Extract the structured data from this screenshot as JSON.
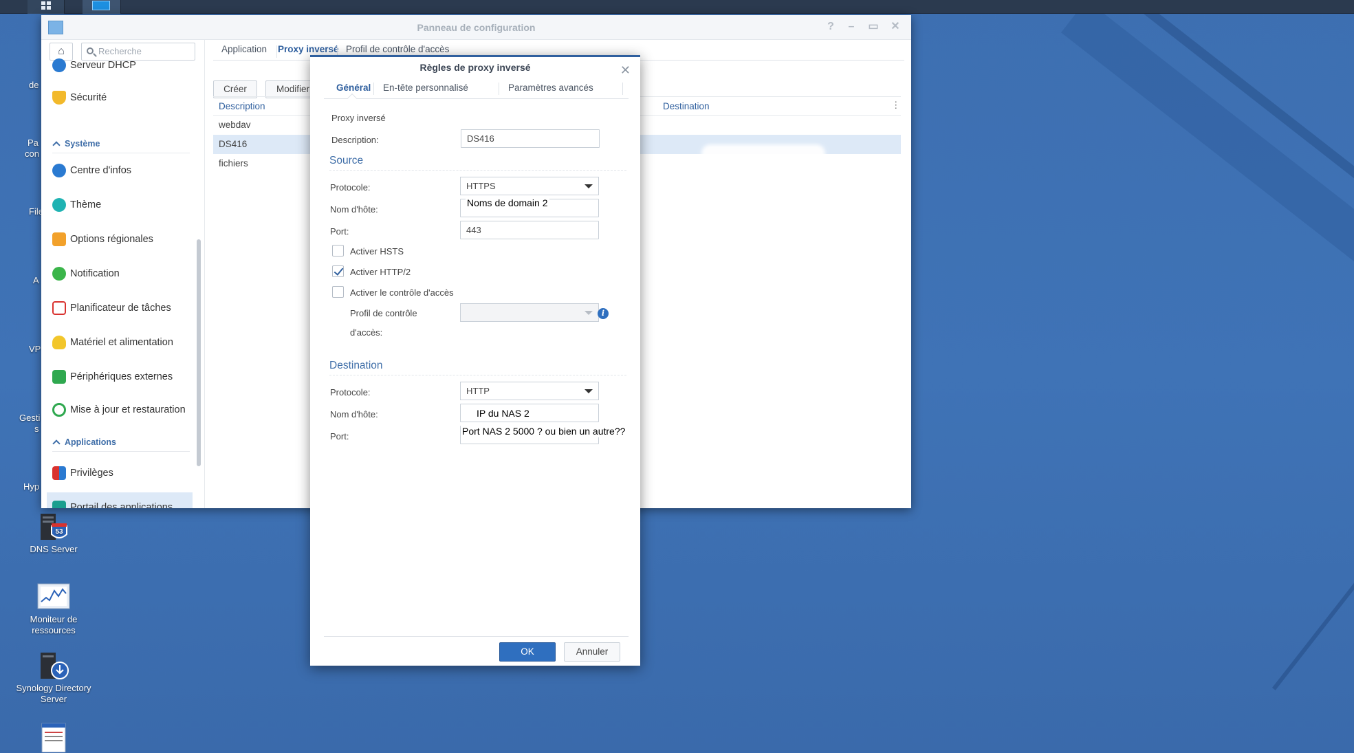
{
  "window": {
    "title": "Panneau de configuration"
  },
  "search": {
    "placeholder": "Recherche"
  },
  "sidebar": {
    "items": [
      {
        "label": "Serveur DHCP"
      },
      {
        "label": "Sécurité"
      },
      {
        "label": "Centre d'infos"
      },
      {
        "label": "Thème"
      },
      {
        "label": "Options régionales"
      },
      {
        "label": "Notification"
      },
      {
        "label": "Planificateur de tâches"
      },
      {
        "label": "Matériel et alimentation"
      },
      {
        "label": "Périphériques externes"
      },
      {
        "label": "Mise à jour et restauration"
      },
      {
        "label": "Privilèges"
      },
      {
        "label": "Portail des applications"
      }
    ],
    "sections": {
      "system": "Système",
      "apps": "Applications"
    }
  },
  "main": {
    "tabs": [
      "Application",
      "Proxy inversé",
      "Profil de contrôle d'accès"
    ],
    "buttons": {
      "create": "Créer",
      "modify": "Modifier"
    },
    "columns": {
      "description": "Description",
      "destination": "Destination"
    },
    "rows": [
      "webdav",
      "DS416",
      "fichiers"
    ]
  },
  "dialog": {
    "title": "Règles de proxy inversé",
    "tabs": [
      "Général",
      "En-tête personnalisé",
      "Paramètres avancés"
    ],
    "heading": "Proxy inversé",
    "description_label": "Description:",
    "description_value": "DS416",
    "source": {
      "title": "Source",
      "protocol_label": "Protocole:",
      "protocol_value": "HTTPS",
      "host_label": "Nom d'hôte:",
      "host_note": "Noms de domain 2",
      "port_label": "Port:",
      "port_value": "443",
      "hsts": "Activer HSTS",
      "http2": "Activer HTTP/2",
      "acl": "Activer le contrôle d'accès",
      "profile_label_1": "Profil de contrôle",
      "profile_label_2": "d'accès:",
      "hsts_checked": false,
      "http2_checked": true,
      "acl_checked": false
    },
    "destination": {
      "title": "Destination",
      "protocol_label": "Protocole:",
      "protocol_value": "HTTP",
      "host_label": "Nom d'hôte:",
      "host_note": "IP du NAS 2",
      "port_label": "Port:",
      "port_note": "Port NAS 2 5000 ? ou bien un autre??"
    },
    "ok": "OK",
    "cancel": "Annuler"
  },
  "desktop": {
    "icons": [
      {
        "label": "DNS Server"
      },
      {
        "label": "Moniteur de ressources"
      },
      {
        "label": "Synology Directory Server"
      }
    ],
    "left_clipped": [
      "de",
      "Pa",
      "con",
      "File",
      "A",
      "VP",
      "Gesti",
      "s",
      "Hyp"
    ]
  }
}
